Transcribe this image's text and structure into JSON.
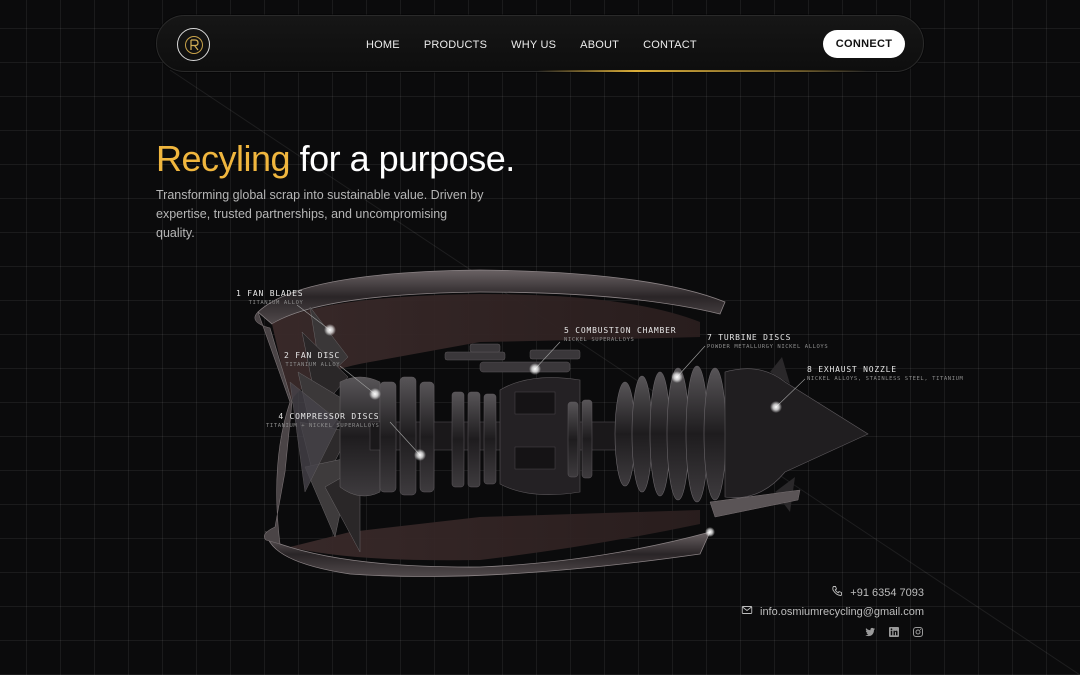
{
  "nav": {
    "logo_icon": "osmium-logo-icon",
    "links": [
      "HOME",
      "PRODUCTS",
      "WHY US",
      "ABOUT",
      "CONTACT"
    ],
    "cta_label": "CONNECT"
  },
  "hero": {
    "headline_accent": "Recyling",
    "headline_rest": "for a purpose.",
    "subtitle_line1": "Transforming global scrap into sustainable value. Driven by",
    "subtitle_line2": "expertise, trusted partnerships, and uncompromising quality."
  },
  "engine": {
    "callouts": [
      {
        "title": "1 FAN BLADES",
        "material": "TITANIUM ALLOY"
      },
      {
        "title": "2 FAN DISC",
        "material": "TITANIUM ALLOY"
      },
      {
        "title": "4 COMPRESSOR DISCS",
        "material": "TITANIUM + NICKEL SUPERALLOYS"
      },
      {
        "title": "5 COMBUSTION CHAMBER",
        "material": "NICKEL SUPERALLOYS"
      },
      {
        "title": "7 TURBINE DISCS",
        "material": "POWDER METALLURGY NICKEL ALLOYS"
      },
      {
        "title": "8 EXHAUST NOZZLE",
        "material": "NICKEL ALLOYS, STAINLESS STEEL, TITANIUM"
      }
    ]
  },
  "contact": {
    "phone": "+91 6354 7093",
    "email": "info.osmiumrecycling@gmail.com",
    "phone_icon": "phone-icon",
    "email_icon": "mail-icon",
    "socials": [
      "twitter-icon",
      "linkedin-icon",
      "instagram-icon"
    ]
  },
  "colors": {
    "accent": "#f0b63e",
    "background": "#0b0b0c"
  }
}
